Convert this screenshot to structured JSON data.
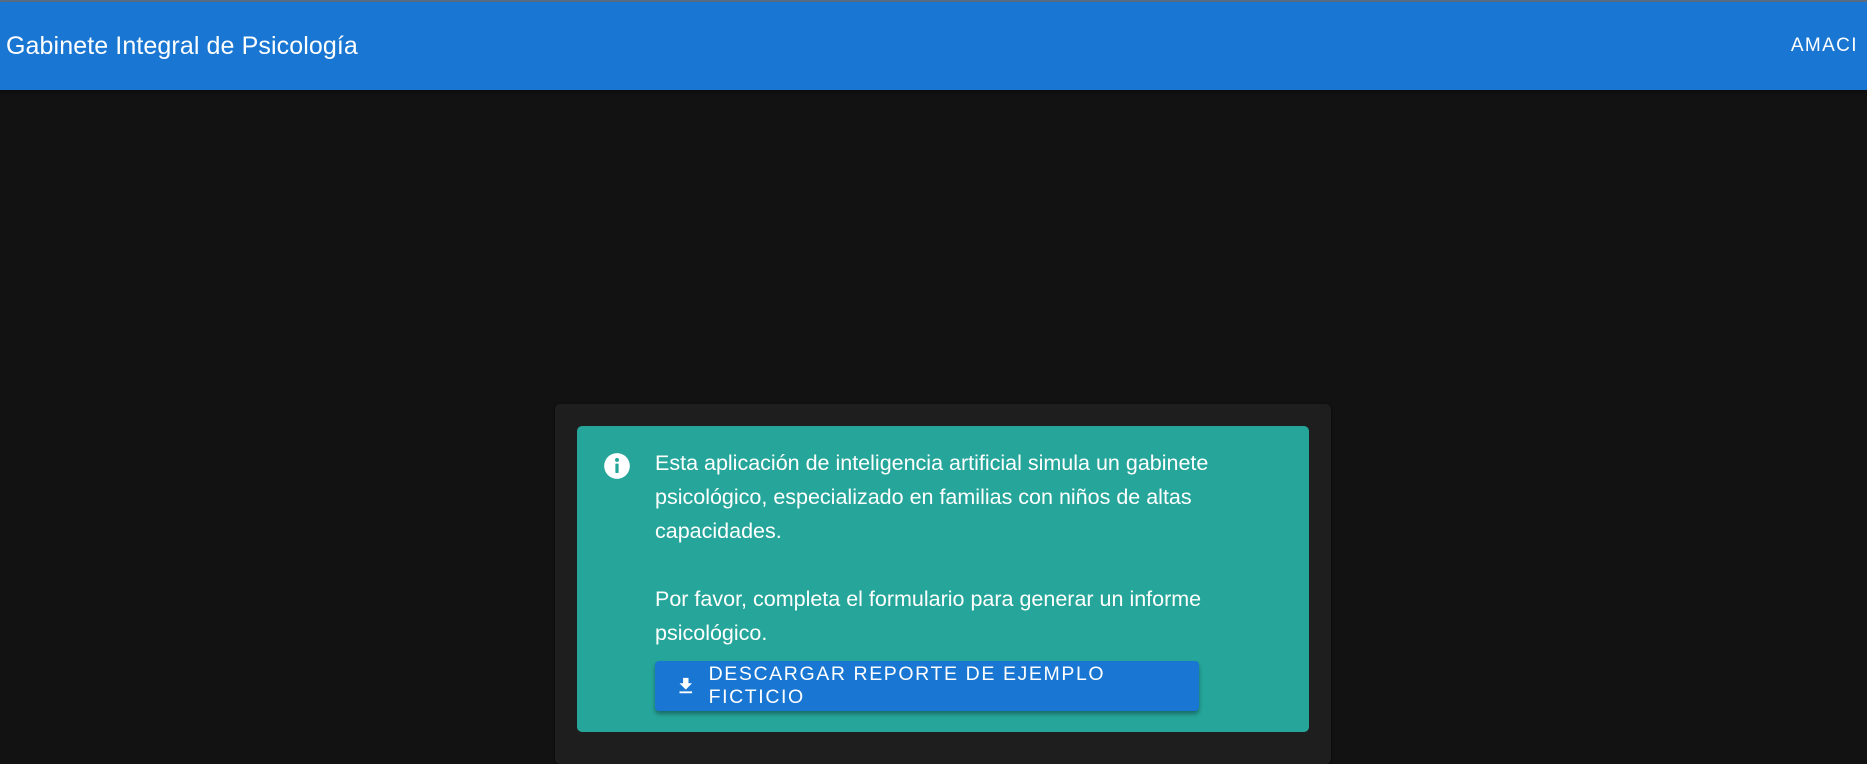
{
  "app_bar": {
    "title": "Gabinete Integral de Psicología",
    "brand_button": "AMACI",
    "color": "#1976d2"
  },
  "card": {
    "alert": {
      "icon": "info-icon",
      "color": "#26a69a",
      "message": "Esta aplicación de inteligencia artificial simula un gabinete psicológico, especializado en familias con niños de altas capacidades.\n\nPor favor, completa el formulario para generar un informe psicológico.",
      "download_button": {
        "icon": "download-icon",
        "label": "DESCARGAR REPORTE DE EJEMPLO FICTICIO"
      }
    }
  }
}
